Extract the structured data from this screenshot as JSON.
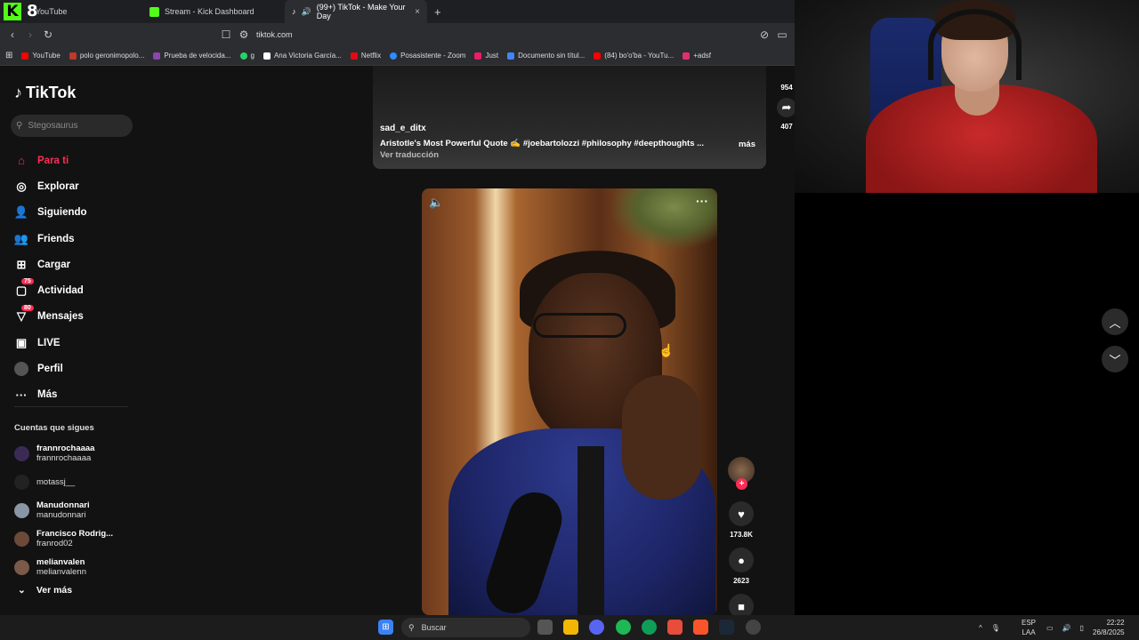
{
  "browser": {
    "tabs": [
      {
        "label": "YouTube",
        "color": "#ff0000",
        "active": false
      },
      {
        "label": "Stream - Kick Dashboard",
        "color": "#53fc18",
        "active": false
      },
      {
        "label": "(99+) TikTok - Make Your Day",
        "color": "#ffffff",
        "active": true
      }
    ],
    "new_tab": "+",
    "close_tab": "×",
    "url": "tiktok.com",
    "overlay_logo": "K",
    "overlay_number": "8",
    "bookmarks": [
      {
        "label": "YouTube",
        "color": "#ff0000"
      },
      {
        "label": "polo geronimopolo...",
        "color": "#c0392b"
      },
      {
        "label": "Prueba de velocida...",
        "color": "#8e44ad"
      },
      {
        "label": "g",
        "color": "#25d366"
      },
      {
        "label": "Ana Victoria García...",
        "color": "#ffffff"
      },
      {
        "label": "Netflix",
        "color": "#e50914"
      },
      {
        "label": "Posasistente - Zoom",
        "color": "#2d8cff"
      },
      {
        "label": "Just",
        "color": "#e91e63"
      },
      {
        "label": "Documento sin títul...",
        "color": "#4285f4"
      },
      {
        "label": "(84) bo'o'ba - YouTu...",
        "color": "#ff0000"
      },
      {
        "label": "+adsf",
        "color": "#e1306c"
      }
    ]
  },
  "tiktok": {
    "brand": "TikTok",
    "search_placeholder": "Stegosaurus",
    "menu": [
      {
        "label": "Para ti",
        "icon": "home-icon",
        "active": true
      },
      {
        "label": "Explorar",
        "icon": "compass-icon"
      },
      {
        "label": "Siguiendo",
        "icon": "following-icon"
      },
      {
        "label": "Friends",
        "icon": "friends-icon"
      },
      {
        "label": "Cargar",
        "icon": "upload-icon"
      },
      {
        "label": "Actividad",
        "icon": "activity-icon",
        "badge": "75"
      },
      {
        "label": "Mensajes",
        "icon": "messages-icon",
        "badge": "80"
      },
      {
        "label": "LIVE",
        "icon": "live-icon"
      },
      {
        "label": "Perfil",
        "icon": "profile-icon"
      },
      {
        "label": "Más",
        "icon": "more-icon"
      }
    ],
    "following_title": "Cuentas que sigues",
    "following": [
      {
        "name": "frannrochaaaa",
        "user": "frannrochaaaa"
      },
      {
        "name": "",
        "user": "motassj__"
      },
      {
        "name": "Manudonnari",
        "user": "manudonnari"
      },
      {
        "name": "Francisco Rodrig...",
        "user": "franrod02"
      },
      {
        "name": "melianvalen",
        "user": "melianvalenn"
      }
    ],
    "see_more": "Ver más",
    "prev_video": {
      "user": "sad_e_ditx",
      "description": "Aristotle's Most Powerful Quote ✍️ #joebartolozzi #philosophy #deepthoughts ...",
      "more": "más",
      "translate": "Ver traducción",
      "share_count": "954",
      "other_count": "407"
    },
    "current_video": {
      "likes": "173.8K",
      "comments": "2623"
    }
  },
  "taskbar": {
    "search_placeholder": "Buscar",
    "lang_top": "ESP",
    "lang_bottom": "LAA",
    "time": "22:22",
    "date": "26/8/2025"
  }
}
